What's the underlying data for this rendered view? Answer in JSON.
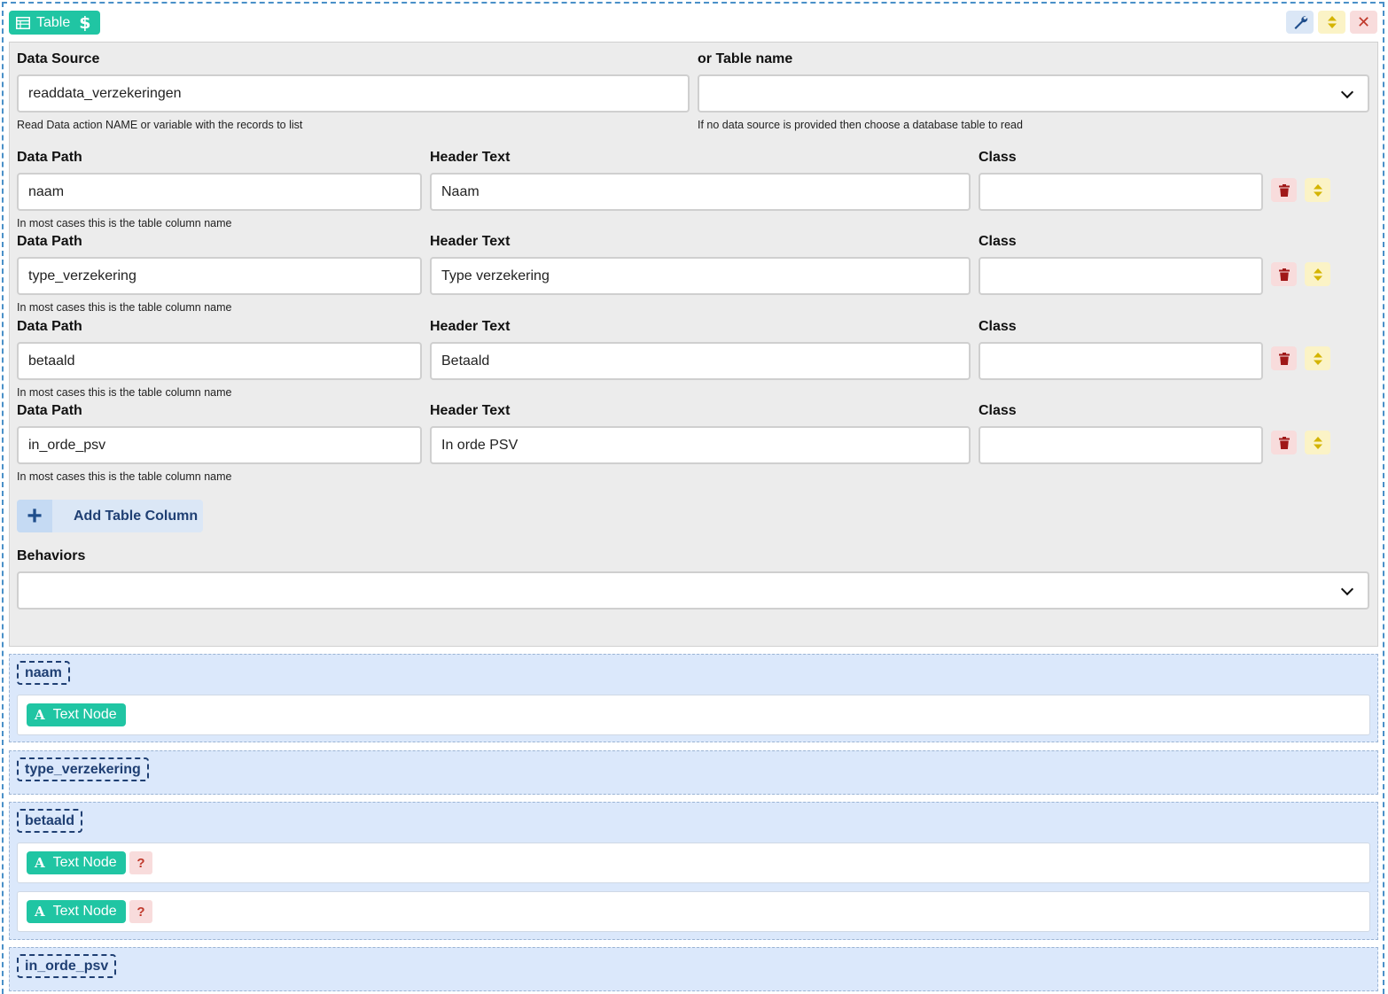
{
  "component": {
    "badge_label": "Table",
    "dollar_symbol": "$",
    "close_symbol": "✕"
  },
  "data_source": {
    "label": "Data Source",
    "value": "readdata_verzekeringen",
    "help": "Read Data action NAME or variable with the records to list"
  },
  "table_name": {
    "label": "or Table name",
    "value": "",
    "help": "If no data source is provided then choose a database table to read"
  },
  "columns": [
    {
      "path_label": "Data Path",
      "path": "naam",
      "header_label": "Header Text",
      "header": "Naam",
      "class_label": "Class",
      "class": "",
      "help": "In most cases this is the table column name"
    },
    {
      "path_label": "Data Path",
      "path": "type_verzekering",
      "header_label": "Header Text",
      "header": "Type verzekering",
      "class_label": "Class",
      "class": "",
      "help": "In most cases this is the table column name"
    },
    {
      "path_label": "Data Path",
      "path": "betaald",
      "header_label": "Header Text",
      "header": "Betaald",
      "class_label": "Class",
      "class": "",
      "help": "In most cases this is the table column name"
    },
    {
      "path_label": "Data Path",
      "path": "in_orde_psv",
      "header_label": "Header Text",
      "header": "In orde PSV",
      "class_label": "Class",
      "class": "",
      "help": "In most cases this is the table column name"
    }
  ],
  "add_column": {
    "plus": "+",
    "label": "Add Table Column"
  },
  "behaviors": {
    "label": "Behaviors",
    "value": ""
  },
  "slots": [
    {
      "name": "naam",
      "nodes": [
        {
          "label": "Text Node",
          "icon": "A",
          "warning": null
        }
      ]
    },
    {
      "name": "type_verzekering",
      "nodes": []
    },
    {
      "name": "betaald",
      "nodes": [
        {
          "label": "Text Node",
          "icon": "A",
          "warning": "?"
        },
        {
          "label": "Text Node",
          "icon": "A",
          "warning": "?"
        }
      ]
    },
    {
      "name": "in_orde_psv",
      "nodes": []
    }
  ],
  "colors": {
    "accent_teal": "#20c5a3",
    "slot_background": "#dbe8fb",
    "danger": "#c0392b",
    "warning_yellow": "#d4b400",
    "primary_blue": "#1f4e8c"
  }
}
